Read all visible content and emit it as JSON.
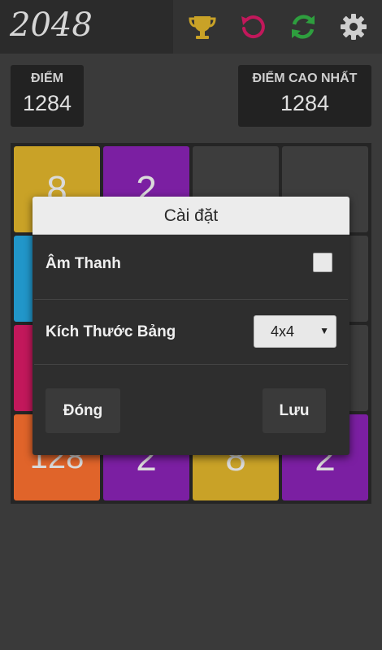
{
  "app": {
    "title": "2048"
  },
  "toolbar": {
    "icons": [
      "trophy-icon",
      "undo-icon",
      "refresh-icon",
      "settings-icon"
    ]
  },
  "scores": {
    "score_label": "ĐIỂM",
    "score_value": "1284",
    "best_label": "ĐIỂM CAO NHẤT",
    "best_value": "1284"
  },
  "board": {
    "size": "4x4",
    "visible_tiles": [
      {
        "value": "8",
        "color": "#c9a227"
      },
      {
        "value": "2",
        "color": "#7b1fa2"
      },
      {
        "value": "",
        "color": "#3d3d3d"
      },
      {
        "value": "",
        "color": "#3d3d3d"
      },
      {
        "value": "",
        "color": "#2196c9"
      },
      {
        "value": "",
        "color": "#3d3d3d"
      },
      {
        "value": "",
        "color": "#3d3d3d"
      },
      {
        "value": "",
        "color": "#3d3d3d"
      },
      {
        "value": "",
        "color": "#c2185b"
      },
      {
        "value": "",
        "color": "#3d3d3d"
      },
      {
        "value": "",
        "color": "#3d3d3d"
      },
      {
        "value": "",
        "color": "#3d3d3d"
      },
      {
        "value": "128",
        "color": "#e0642a"
      },
      {
        "value": "2",
        "color": "#7b1fa2"
      },
      {
        "value": "8",
        "color": "#c9a227"
      },
      {
        "value": "2",
        "color": "#7b1fa2"
      }
    ]
  },
  "settings_dialog": {
    "title": "Cài đặt",
    "sound_label": "Âm Thanh",
    "sound_enabled": false,
    "board_size_label": "Kích Thước Bảng",
    "board_size_value": "4x4",
    "close_button": "Đóng",
    "save_button": "Lưu"
  },
  "colors": {
    "background": "#3a3a3a",
    "trophy": "#c9a227",
    "undo": "#c2185b",
    "refresh": "#2e9e3e",
    "settings": "#cfcfcf"
  }
}
